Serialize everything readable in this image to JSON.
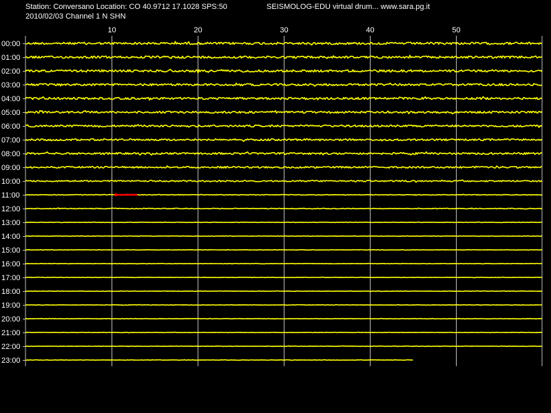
{
  "header": {
    "station_line": "Station: Conversano Location: CO 40.9712 17.1028 SPS:50",
    "date_line": "2010/02/03  Channel 1 N SHN",
    "brand": "SEISMOLOG-EDU virtual drum... www.sara.pg.it"
  },
  "colors": {
    "background": "#000000",
    "trace": "#ffff00",
    "grid": "#c0c0c0",
    "event_marker": "#ff0000",
    "text": "#ffffff"
  },
  "chart_data": {
    "type": "line",
    "title": "",
    "xlabel": "",
    "ylabel": "",
    "x_ticks": [
      10,
      20,
      30,
      40,
      50
    ],
    "xlim": [
      0,
      60
    ],
    "grid": true,
    "rows": [
      "00:00",
      "01:00",
      "02:00",
      "03:00",
      "04:00",
      "05:00",
      "06:00",
      "07:00",
      "08:00",
      "09:00",
      "10:00",
      "11:00",
      "12:00",
      "13:00",
      "14:00",
      "15:00",
      "16:00",
      "17:00",
      "18:00",
      "19:00",
      "20:00",
      "21:00",
      "22:00",
      "23:00"
    ],
    "row_noise": [
      1.6,
      1.6,
      1.6,
      1.5,
      1.5,
      1.4,
      1.4,
      1.3,
      1.3,
      1.2,
      1.0,
      0.5,
      0.5,
      0.3,
      0.3,
      0.3,
      0.3,
      0.3,
      0.3,
      0.3,
      0.3,
      0.3,
      0.3,
      0.3
    ],
    "last_row_end_minute": 45,
    "event_marker": {
      "row": "11:00",
      "start_minute": 10.5,
      "end_minute": 13
    }
  }
}
